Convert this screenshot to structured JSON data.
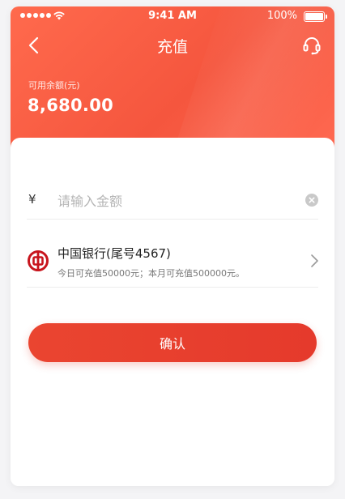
{
  "status_bar": {
    "time": "9:41 AM",
    "battery": "100%"
  },
  "nav": {
    "title": "充值",
    "back_icon": "chevron-left-icon",
    "service_icon": "headset-icon"
  },
  "balance": {
    "label": "可用余额(元)",
    "value": "8,680.00"
  },
  "amount": {
    "currency_symbol": "¥",
    "placeholder": "请输入金额",
    "value": ""
  },
  "bank": {
    "name": "中国银行(尾号4567)",
    "limit": "今日可充值50000元；本月可充值500000元。",
    "logo_icon": "bank-of-china-logo"
  },
  "confirm_label": "确认",
  "colors": {
    "header_start": "#ff6a4d",
    "header_end": "#f5563e",
    "accent": "#e53a2c",
    "bank_red": "#c8151d"
  }
}
